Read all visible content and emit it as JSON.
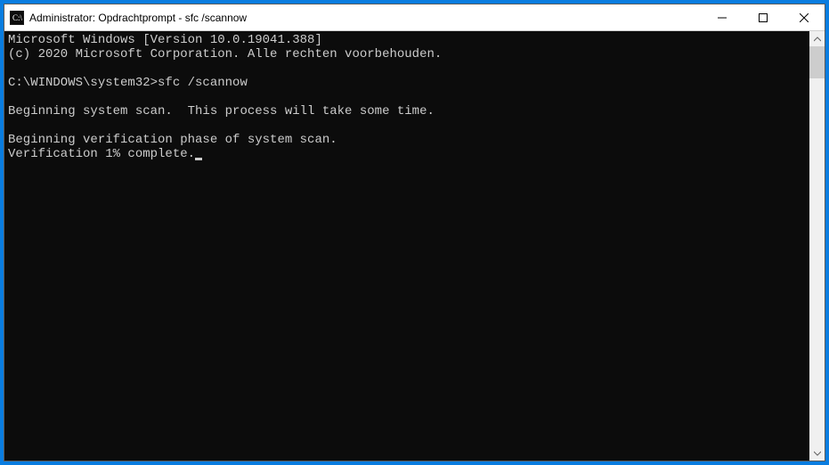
{
  "titlebar": {
    "title": "Administrator: Opdrachtprompt - sfc  /scannow"
  },
  "terminal": {
    "lines": [
      "Microsoft Windows [Version 10.0.19041.388]",
      "(c) 2020 Microsoft Corporation. Alle rechten voorbehouden.",
      "",
      "C:\\WINDOWS\\system32>sfc /scannow",
      "",
      "Beginning system scan.  This process will take some time.",
      "",
      "Beginning verification phase of system scan.",
      "Verification 1% complete."
    ]
  }
}
